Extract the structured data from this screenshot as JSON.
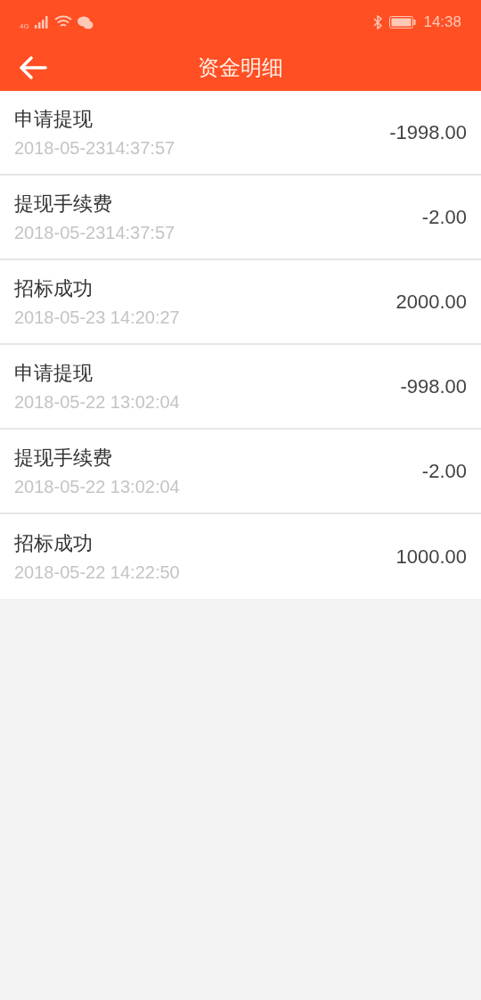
{
  "status_bar": {
    "network": "4G",
    "time": "14:38"
  },
  "header": {
    "title": "资金明细"
  },
  "records": [
    {
      "title": "申请提现",
      "time": "2018-05-2314:37:57",
      "amount": "-1998.00"
    },
    {
      "title": "提现手续费",
      "time": "2018-05-2314:37:57",
      "amount": "-2.00"
    },
    {
      "title": "招标成功",
      "time": "2018-05-23 14:20:27",
      "amount": "2000.00"
    },
    {
      "title": "申请提现",
      "time": "2018-05-22 13:02:04",
      "amount": "-998.00"
    },
    {
      "title": "提现手续费",
      "time": "2018-05-22 13:02:04",
      "amount": "-2.00"
    },
    {
      "title": "招标成功",
      "time": "2018-05-22 14:22:50",
      "amount": "1000.00"
    }
  ]
}
